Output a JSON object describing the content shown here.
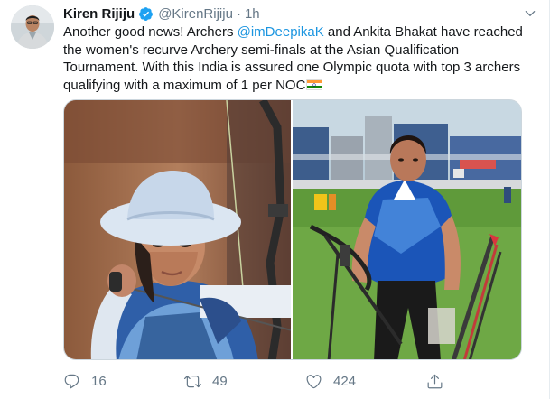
{
  "tweet": {
    "author_name": "Kiren Rijiju",
    "handle": "@KirenRijiju",
    "separator": "·",
    "time": "1h",
    "text_part1": "Another good news! Archers ",
    "mention": "@imDeepikaK",
    "text_part2": " and Ankita Bhakat have reached the women's recurve Archery semi-finals at the Asian Qualification Tournament. With this India is assured one Olympic quota with top 3 archers qualifying with a maximum of 1 per NOC",
    "mention_color": "#1b95e0",
    "verified_color": "#1da1f2"
  },
  "actions": {
    "reply_count": "16",
    "retweet_count": "49",
    "like_count": "424"
  },
  "icons": {
    "reply": "reply-icon",
    "retweet": "retweet-icon",
    "like": "heart-icon",
    "share": "share-icon",
    "caret": "chevron-down-icon",
    "flag": "india-flag-icon"
  }
}
